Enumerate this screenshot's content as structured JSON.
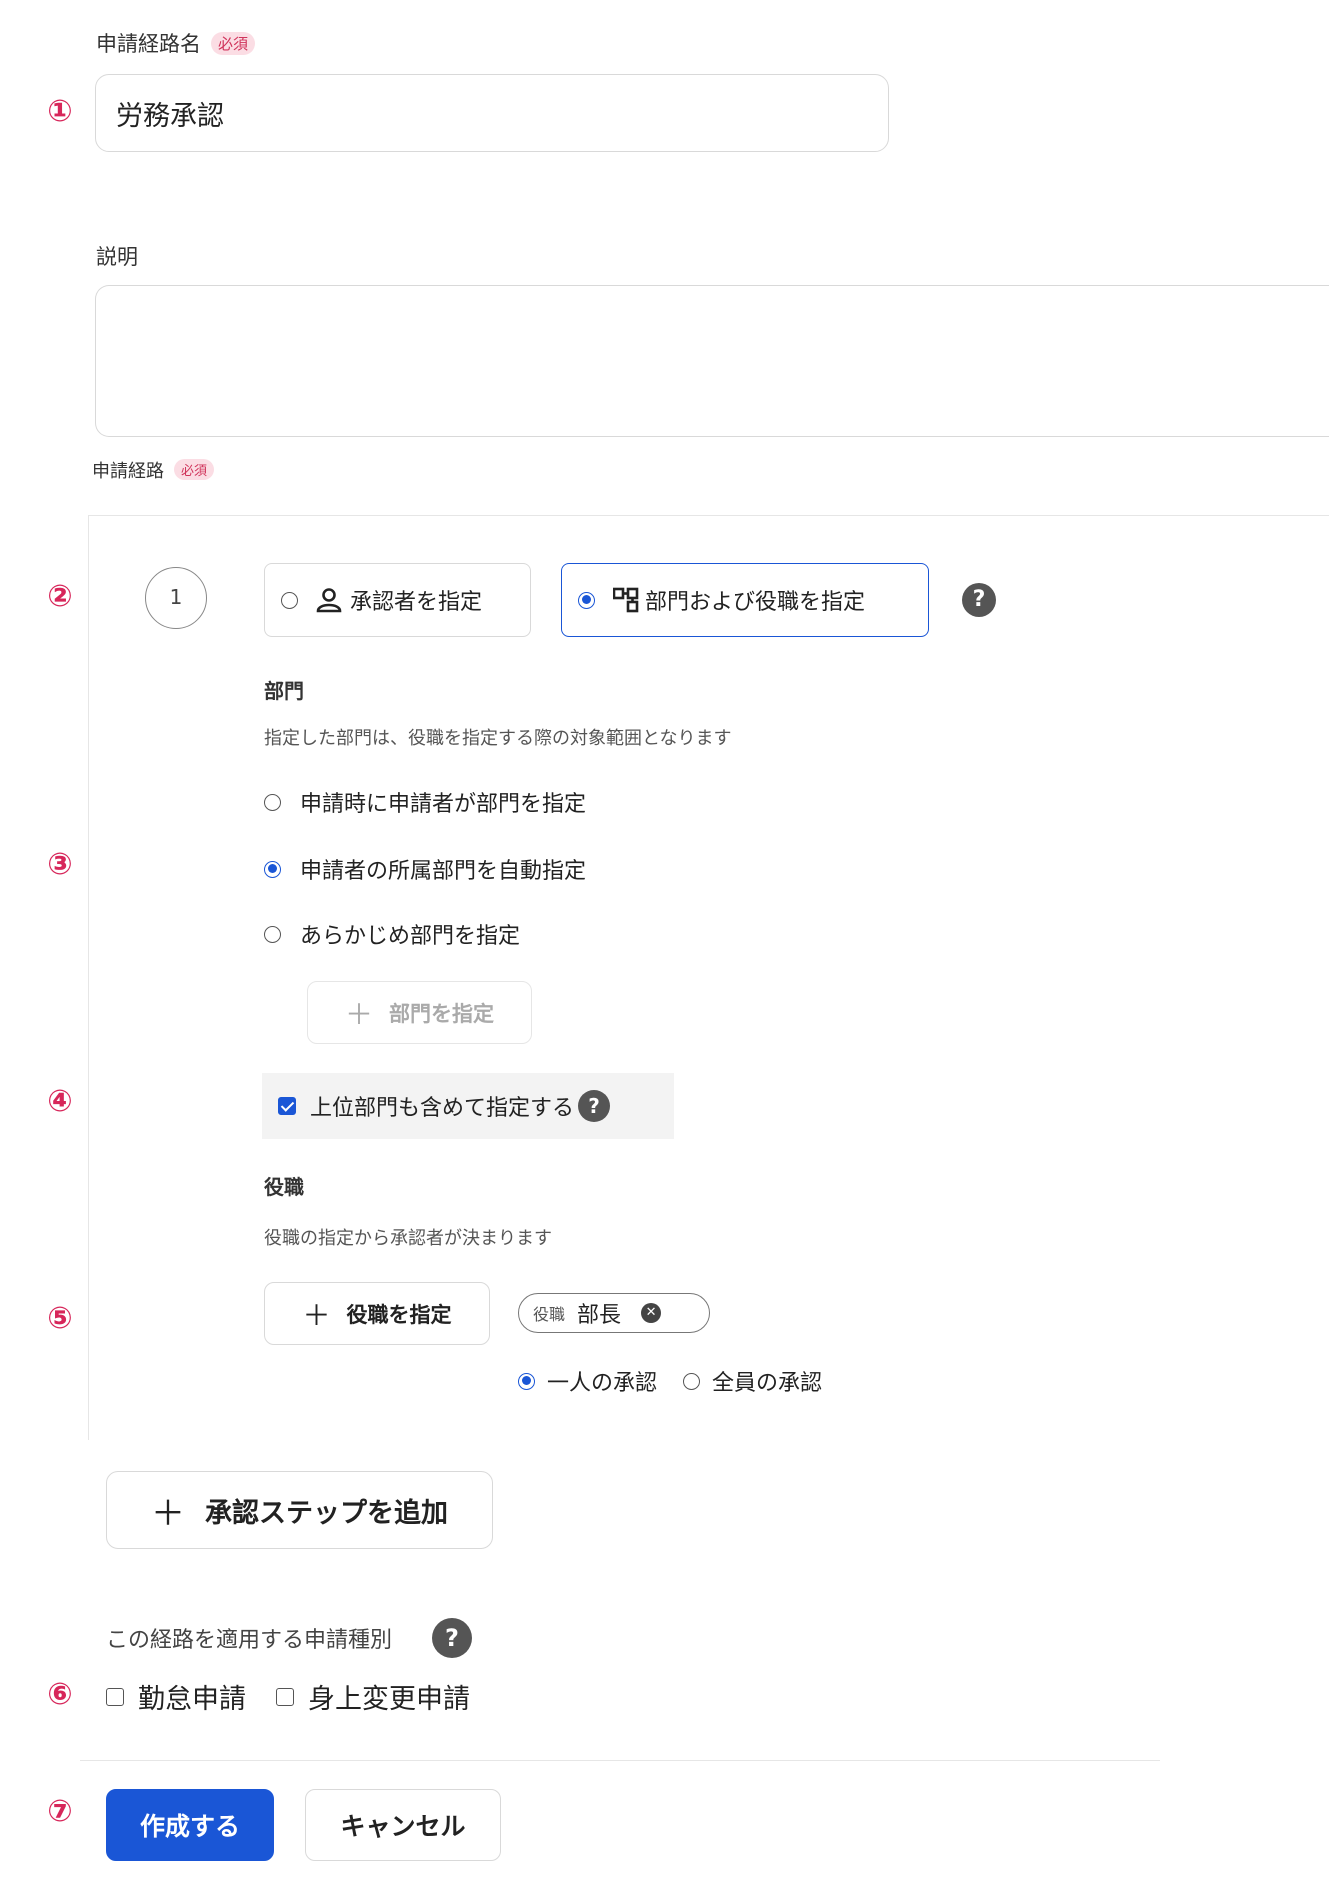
{
  "markers": [
    "①",
    "②",
    "③",
    "④",
    "⑤",
    "⑥",
    "⑦"
  ],
  "route_name": {
    "label": "申請経路名",
    "required": "必須",
    "value": "労務承認"
  },
  "description": {
    "label": "説明",
    "value": ""
  },
  "route": {
    "label": "申請経路",
    "required": "必須"
  },
  "step": {
    "number": "1",
    "options": [
      {
        "label": "承認者を指定",
        "icon": "person-icon",
        "selected": false
      },
      {
        "label": "部門および役職を指定",
        "icon": "org-chart-icon",
        "selected": true
      }
    ],
    "help": "?"
  },
  "department": {
    "title": "部門",
    "desc": "指定した部門は、役職を指定する際の対象範囲となります",
    "choices": [
      {
        "label": "申請時に申請者が部門を指定",
        "selected": false
      },
      {
        "label": "申請者の所属部門を自動指定",
        "selected": true
      },
      {
        "label": "あらかじめ部門を指定",
        "selected": false
      }
    ],
    "add_button": "部門を指定",
    "include_parent": {
      "label": "上位部門も含めて指定する",
      "checked": true
    }
  },
  "position": {
    "title": "役職",
    "desc": "役職の指定から承認者が決まります",
    "add_button": "役職を指定",
    "tag": {
      "prefix": "役職",
      "value": "部長"
    },
    "approval": [
      {
        "label": "一人の承認",
        "selected": true
      },
      {
        "label": "全員の承認",
        "selected": false
      }
    ]
  },
  "add_step_button": "承認ステップを追加",
  "types": {
    "label": "この経路を適用する申請種別",
    "options": [
      {
        "label": "勤怠申請",
        "checked": false
      },
      {
        "label": "身上変更申請",
        "checked": false
      }
    ]
  },
  "actions": {
    "create": "作成する",
    "cancel": "キャンセル"
  },
  "colors": {
    "accent": "#1a56d6",
    "marker": "#d7265a",
    "required_bg": "#fbdde4"
  }
}
